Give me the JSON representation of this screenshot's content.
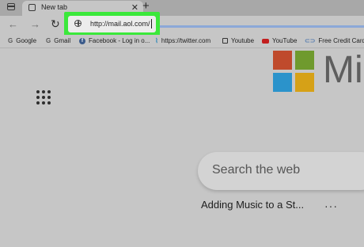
{
  "tab": {
    "title": "New tab",
    "close": "✕"
  },
  "new_tab": "+",
  "nav": {
    "back": "←",
    "forward": "→",
    "refresh": "↻"
  },
  "address_bar": {
    "value": "http://mail.aol.com/"
  },
  "bookmarks": [
    {
      "label": "Google",
      "icon": "G"
    },
    {
      "label": "Gmail",
      "icon": "G"
    },
    {
      "label": "Facebook - Log in o...",
      "icon": "f"
    },
    {
      "label": "https://twitter.com",
      "icon": "⌇"
    },
    {
      "label": "Youtube",
      "icon": ""
    },
    {
      "label": "YouTube",
      "icon": ""
    },
    {
      "label": "Free Credit Card N",
      "icon": "⊂⊃"
    }
  ],
  "brand": {
    "text": "Mi"
  },
  "search": {
    "placeholder": "Search the web"
  },
  "feed": {
    "title": "Adding Music to a St...",
    "more": "···"
  },
  "colors": {
    "highlight": "#3be83b",
    "ms_red": "#bf4a2c",
    "ms_green": "#6f9a2e",
    "ms_blue": "#2b93cb",
    "ms_yellow": "#d6a117"
  }
}
